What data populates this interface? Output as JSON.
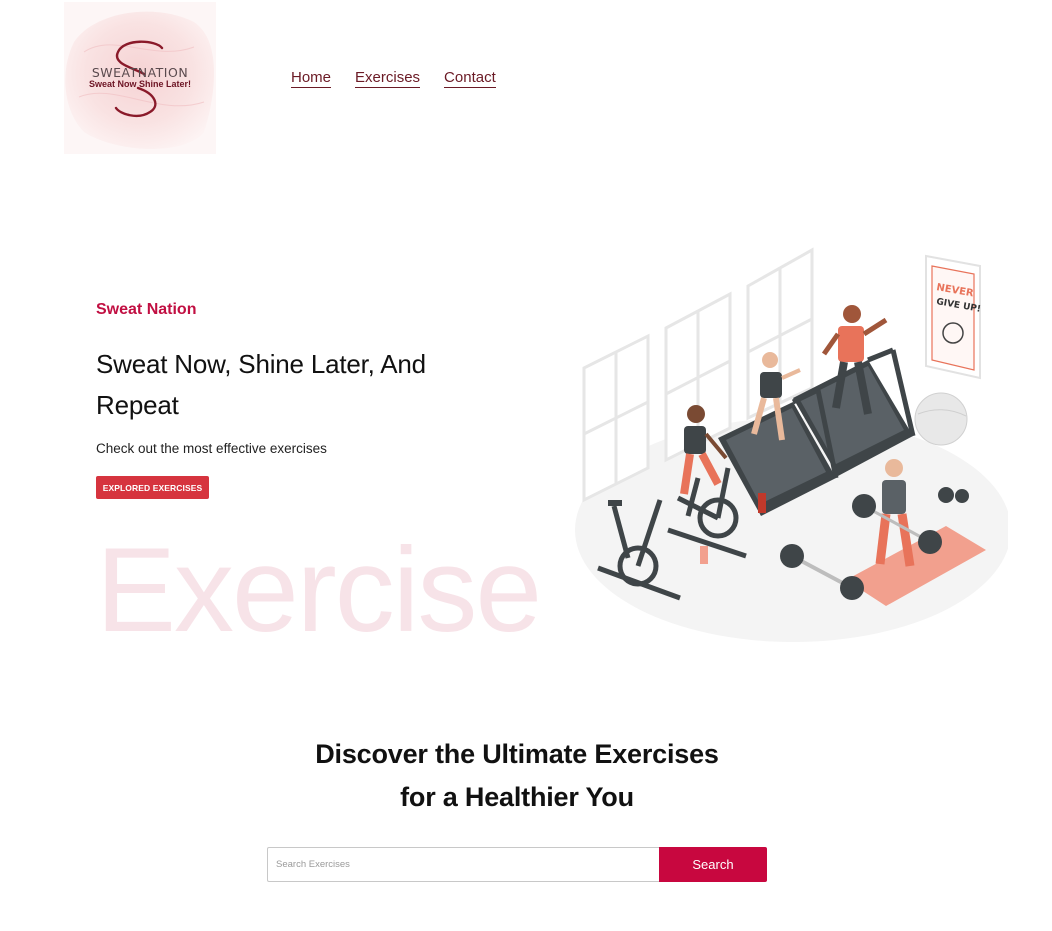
{
  "logo": {
    "brand": "SWEATNATION",
    "tagline": "Sweat Now Shine Later!"
  },
  "nav": {
    "items": [
      {
        "label": "Home"
      },
      {
        "label": "Exercises"
      },
      {
        "label": "Contact"
      }
    ]
  },
  "hero": {
    "eyebrow": "Sweat Nation",
    "title": "Sweat Now, Shine Later, And Repeat",
    "subtitle": "Check out the most effective exercises",
    "button_label": "EXPLORED EXERCISES",
    "watermark": "Exercise",
    "poster_text": "NEVER GIVE UP!"
  },
  "discover": {
    "heading": "Discover the Ultimate Exercises for a Healthier You"
  },
  "search": {
    "placeholder": "Search Exercises",
    "value": "",
    "button_label": "Search"
  },
  "colors": {
    "accent": "#c8073f",
    "button_red": "#d6343e",
    "nav_link": "#6b1a25",
    "watermark": "#f7e3e8"
  }
}
